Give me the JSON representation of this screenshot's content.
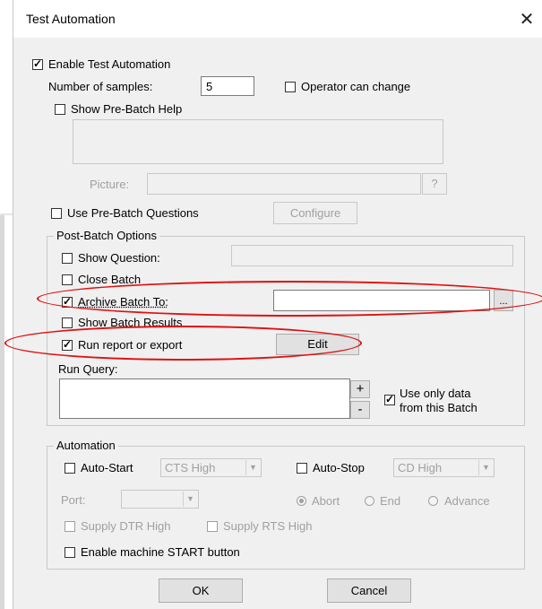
{
  "window": {
    "title": "Test Automation",
    "close_glyph": "✕"
  },
  "enable": {
    "label": "Enable Test Automation",
    "checked": true
  },
  "samples": {
    "label": "Number of samples:",
    "value": "5"
  },
  "operator_change": {
    "label": "Operator can change",
    "checked": false
  },
  "pre_batch_help": {
    "label": "Show Pre-Batch Help",
    "checked": false
  },
  "picture": {
    "label": "Picture:",
    "browse": "?"
  },
  "pre_batch_questions": {
    "label": "Use Pre-Batch Questions",
    "checked": false,
    "configure": "Configure"
  },
  "post_batch": {
    "title": "Post-Batch Options",
    "show_question": "Show Question:",
    "close_batch": "Close Batch",
    "archive_batch": "Archive Batch To:",
    "archive_browse": "...",
    "show_results": "Show Batch Results",
    "run_report": "Run report or export",
    "edit": "Edit",
    "run_query": "Run Query:",
    "plus": "+",
    "minus": "-",
    "use_only_line1": "Use only data",
    "use_only_line2": "from this Batch"
  },
  "automation": {
    "title": "Automation",
    "auto_start": "Auto-Start",
    "auto_start_select": "CTS High",
    "auto_stop": "Auto-Stop",
    "auto_stop_select": "CD High",
    "port": "Port:",
    "abort": "Abort",
    "end": "End",
    "advance": "Advance",
    "dtr": "Supply DTR High",
    "rts": "Supply RTS High",
    "machine_start": "Enable machine START button"
  },
  "buttons": {
    "ok": "OK",
    "cancel": "Cancel"
  },
  "colors": {
    "highlight": "#e01010",
    "dialog_bg": "#f0f0f0",
    "disabled_text": "#a0a0a0"
  }
}
